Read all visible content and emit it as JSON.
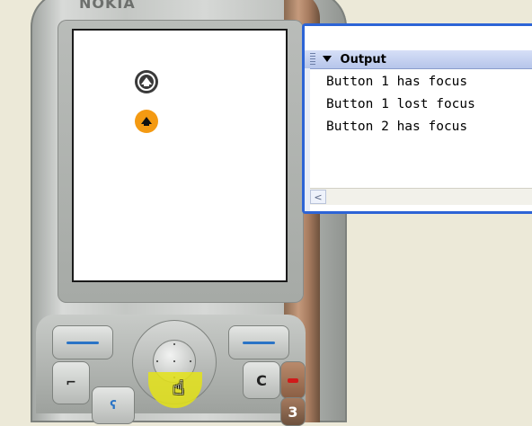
{
  "phone": {
    "brand": "NOKIA",
    "keys": {
      "clear": "C",
      "three": "3",
      "call_symbol": "⌐",
      "green_symbol": "ʕ"
    }
  },
  "screen": {
    "buttons": [
      {
        "name": "Button 1",
        "icon": "up-arrow-circle-icon",
        "color": "#3a3a3a",
        "focused": false
      },
      {
        "name": "Button 2",
        "icon": "up-arrow-circle-icon",
        "color": "#f49a12",
        "focused": true
      }
    ]
  },
  "output_panel": {
    "title": "Output",
    "lines": [
      "Button 1 has focus",
      "Button 1 lost focus",
      "Button 2 has focus"
    ]
  },
  "colors": {
    "panel_border": "#2d64d6",
    "focus_orange": "#f49a12",
    "soft_key_blue": "#2a74c6",
    "highlight_yellow": "#e4e318"
  }
}
